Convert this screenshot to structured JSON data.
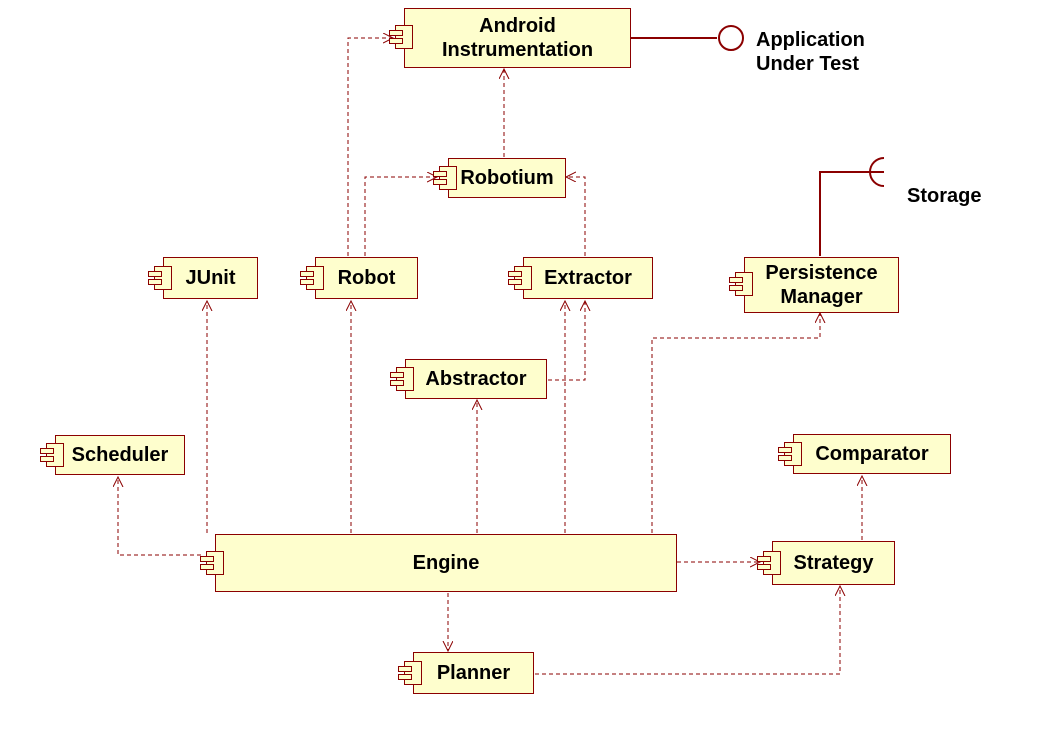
{
  "components": {
    "androidInstr": "Android\nInstrumentation",
    "robotium": "Robotium",
    "junit": "JUnit",
    "robot": "Robot",
    "extractor": "Extractor",
    "persistence": "Persistence\nManager",
    "abstractor": "Abstractor",
    "scheduler": "Scheduler",
    "comparator": "Comparator",
    "engine": "Engine",
    "strategy": "Strategy",
    "planner": "Planner"
  },
  "interfaces": {
    "appUnderTest": "Application\nUnder Test",
    "storage": "Storage"
  }
}
